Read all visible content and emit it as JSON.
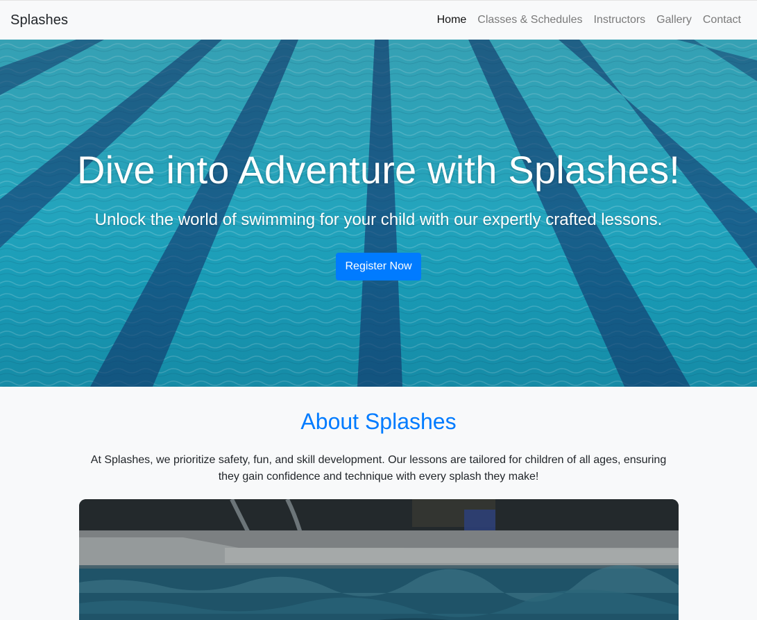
{
  "navbar": {
    "brand": "Splashes",
    "links": [
      {
        "label": "Home",
        "active": true
      },
      {
        "label": "Classes & Schedules",
        "active": false
      },
      {
        "label": "Instructors",
        "active": false
      },
      {
        "label": "Gallery",
        "active": false
      },
      {
        "label": "Contact",
        "active": false
      }
    ]
  },
  "hero": {
    "title": "Dive into Adventure with Splashes!",
    "subtitle": "Unlock the world of swimming for your child with our expertly crafted lessons.",
    "button_label": "Register Now"
  },
  "about": {
    "title": "About Splashes",
    "text": "At Splashes, we prioritize safety, fun, and skill development. Our lessons are tailored for children of all ages, ensuring they gain confidence and technique with every splash they make!"
  },
  "colors": {
    "primary": "#007bff",
    "navbar_bg": "#f8f9fa",
    "nav_link": "#7a7a7a",
    "nav_link_active": "#111111"
  }
}
